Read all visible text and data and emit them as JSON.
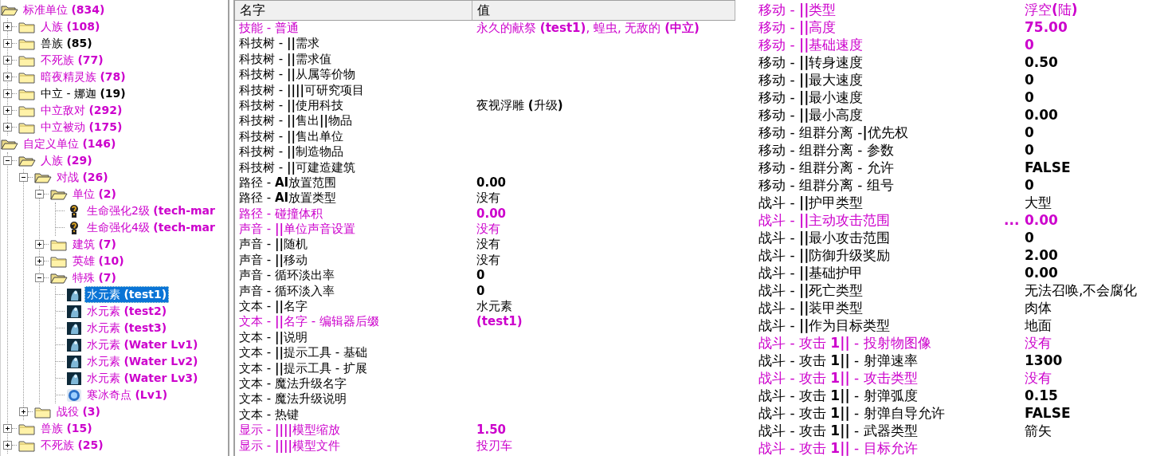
{
  "tree": [
    {
      "label": "标准单位 **(834)**",
      "kind": "folder",
      "expanded": true,
      "highlighted": true,
      "selected": false,
      "children": [
        {
          "label": "人族 **(108)**",
          "kind": "folder",
          "expanded": false,
          "highlighted": true,
          "selected": false
        },
        {
          "label": "兽族 **(85)**",
          "kind": "folder",
          "expanded": false,
          "highlighted": false,
          "selected": false
        },
        {
          "label": "不死族 **(77)**",
          "kind": "folder",
          "expanded": false,
          "highlighted": true,
          "selected": false
        },
        {
          "label": "暗夜精灵族 **(78)**",
          "kind": "folder",
          "expanded": false,
          "highlighted": true,
          "selected": false
        },
        {
          "label": "中立 - 娜迦 **(19)**",
          "kind": "folder",
          "expanded": false,
          "highlighted": false,
          "selected": false
        },
        {
          "label": "中立敌对 **(292)**",
          "kind": "folder",
          "expanded": false,
          "highlighted": true,
          "selected": false
        },
        {
          "label": "中立被动 **(175)**",
          "kind": "folder",
          "expanded": false,
          "highlighted": true,
          "selected": false
        }
      ]
    },
    {
      "label": "自定义单位 **(146)**",
      "kind": "folder",
      "expanded": true,
      "highlighted": true,
      "selected": false,
      "children": [
        {
          "label": "人族 **(29)**",
          "kind": "folder",
          "expanded": true,
          "highlighted": true,
          "selected": false,
          "children": [
            {
              "label": "对战 **(26)**",
              "kind": "folder",
              "expanded": true,
              "highlighted": true,
              "selected": false,
              "children": [
                {
                  "label": "单位 **(2)**",
                  "kind": "folder",
                  "expanded": true,
                  "highlighted": true,
                  "selected": false,
                  "children": [
                    {
                      "label": "生命强化2级 **(tech-mar**",
                      "kind": "upgrade",
                      "highlighted": true,
                      "selected": false
                    },
                    {
                      "label": "生命强化4级 **(tech-mar**",
                      "kind": "upgrade",
                      "highlighted": true,
                      "selected": false
                    }
                  ]
                },
                {
                  "label": "建筑 **(7)**",
                  "kind": "folder",
                  "expanded": false,
                  "highlighted": true,
                  "selected": false
                },
                {
                  "label": "英雄 **(10)**",
                  "kind": "folder",
                  "expanded": false,
                  "highlighted": true,
                  "selected": false
                },
                {
                  "label": "特殊 **(7)**",
                  "kind": "folder",
                  "expanded": true,
                  "highlighted": true,
                  "selected": false,
                  "children": [
                    {
                      "label": "水元素 **(test1)**",
                      "kind": "water",
                      "highlighted": true,
                      "selected": true
                    },
                    {
                      "label": "水元素 **(test2)**",
                      "kind": "water",
                      "highlighted": true,
                      "selected": false
                    },
                    {
                      "label": "水元素 **(test3)**",
                      "kind": "water",
                      "highlighted": true,
                      "selected": false
                    },
                    {
                      "label": "水元素 **(Water Lv1)**",
                      "kind": "water",
                      "highlighted": true,
                      "selected": false
                    },
                    {
                      "label": "水元素 **(Water Lv2)**",
                      "kind": "water",
                      "highlighted": true,
                      "selected": false
                    },
                    {
                      "label": "水元素 **(Water Lv3)**",
                      "kind": "water",
                      "highlighted": true,
                      "selected": false
                    },
                    {
                      "label": "寒冰奇点 **(Lv1)**",
                      "kind": "ice",
                      "highlighted": true,
                      "selected": false
                    }
                  ]
                }
              ]
            },
            {
              "label": "战役 **(3)**",
              "kind": "folder",
              "expanded": false,
              "highlighted": true,
              "selected": false
            }
          ]
        },
        {
          "label": "兽族 **(15)**",
          "kind": "folder",
          "expanded": false,
          "highlighted": true,
          "selected": false
        },
        {
          "label": "不死族 **(25)**",
          "kind": "folder",
          "expanded": false,
          "highlighted": true,
          "selected": false
        }
      ]
    }
  ],
  "table": {
    "columns": [
      "名字",
      "值"
    ],
    "rows": [
      {
        "name": "技能 - 普通",
        "value": "永久的献祭 **(test1)**, 蝗虫, 无敌的 **(中立)**",
        "kind": "text",
        "highlighted": true
      },
      {
        "name": "科技树 - **||**需求",
        "highlighted": false
      },
      {
        "name": "科技树 - **||**需求值",
        "highlighted": false
      },
      {
        "name": "科技树 - **||**从属等价物",
        "highlighted": false
      },
      {
        "name": "科技树 - **||||**可研究项目",
        "highlighted": false
      },
      {
        "name": "科技树 - **||**使用科技",
        "value": "夜视浮雕 **(**升级**)**",
        "kind": "text",
        "highlighted": false
      },
      {
        "name": "科技树 - **||**售出**||**物品",
        "highlighted": false
      },
      {
        "name": "科技树 - **||**售出单位",
        "highlighted": false
      },
      {
        "name": "科技树 - **||**制造物品",
        "highlighted": false
      },
      {
        "name": "科技树 - **||**可建造建筑",
        "highlighted": false
      },
      {
        "name": "路径 - **AI**放置范围",
        "value": "0.00",
        "kind": "number",
        "highlighted": false
      },
      {
        "name": "路径 - **AI**放置类型",
        "value": "没有",
        "kind": "text",
        "highlighted": false
      },
      {
        "name": "路径 - 碰撞体积",
        "value": "0.00",
        "kind": "number",
        "highlighted": true
      },
      {
        "name": "声音 - **||**单位声音设置",
        "value": "没有",
        "kind": "text",
        "highlighted": true
      },
      {
        "name": "声音 - **||**随机",
        "value": "没有",
        "kind": "text",
        "highlighted": false
      },
      {
        "name": "声音 - **||**移动",
        "value": "没有",
        "kind": "text",
        "highlighted": false
      },
      {
        "name": "声音 - 循环淡出率",
        "value": "0",
        "kind": "number",
        "highlighted": false
      },
      {
        "name": "声音 - 循环淡入率",
        "value": "0",
        "kind": "number",
        "highlighted": false
      },
      {
        "name": "文本 - **||**名字",
        "value": "水元素",
        "kind": "text",
        "highlighted": false
      },
      {
        "name": "文本 - **||**名字 - 编辑器后缀",
        "value": "(test1)",
        "kind": "number",
        "highlighted": true
      },
      {
        "name": "文本 - **||**说明",
        "highlighted": false
      },
      {
        "name": "文本 - **||**提示工具 - 基础",
        "highlighted": false
      },
      {
        "name": "文本 - **||**提示工具 - 扩展",
        "highlighted": false
      },
      {
        "name": "文本 - 魔法升级名字",
        "highlighted": false
      },
      {
        "name": "文本 - 魔法升级说明",
        "highlighted": false
      },
      {
        "name": "文本 - 热键",
        "highlighted": false
      },
      {
        "name": "显示 - **||||**模型缩放",
        "value": "1.50",
        "kind": "number",
        "highlighted": true
      },
      {
        "name": "显示 - **||||**模型文件",
        "value": "投刃车",
        "kind": "text",
        "highlighted": true
      }
    ]
  },
  "detail_list": [
    {
      "name": "移动 - **||**类型",
      "value": "浮空**(**陆**)**",
      "kind": "text",
      "highlighted": true
    },
    {
      "name": "移动 - **||**高度",
      "value": "75.00",
      "kind": "number",
      "highlighted": true
    },
    {
      "name": "移动 - **||**基础速度",
      "value": "0",
      "kind": "number",
      "highlighted": true
    },
    {
      "name": "移动 - **||**转身速度",
      "value": "0.50",
      "kind": "number",
      "highlighted": false
    },
    {
      "name": "移动 - **||**最大速度",
      "value": "0",
      "kind": "number",
      "highlighted": false
    },
    {
      "name": "移动 - **||**最小速度",
      "value": "0",
      "kind": "number",
      "highlighted": false
    },
    {
      "name": "移动 - **||**最小高度",
      "value": "0.00",
      "kind": "number",
      "highlighted": false
    },
    {
      "name": "移动 - 组群分离 -**|**优先权",
      "value": "0",
      "kind": "number",
      "highlighted": false
    },
    {
      "name": "移动 - 组群分离 - 参数",
      "value": "0",
      "kind": "number",
      "highlighted": false
    },
    {
      "name": "移动 - 组群分离 - 允许",
      "value": "FALSE",
      "kind": "number",
      "highlighted": false
    },
    {
      "name": "移动 - 组群分离 - 组号",
      "value": "0",
      "kind": "number",
      "highlighted": false
    },
    {
      "name": "战斗 - **||**护甲类型",
      "value": "大型",
      "kind": "text",
      "highlighted": false
    },
    {
      "name": "战斗 - **||**主动攻击范围",
      "marker": "...",
      "value": "0.00",
      "kind": "number",
      "highlighted": true
    },
    {
      "name": "战斗 - **||**最小攻击范围",
      "value": "0",
      "kind": "number",
      "highlighted": false
    },
    {
      "name": "战斗 - **||**防御升级奖励",
      "value": "2.00",
      "kind": "number",
      "highlighted": false
    },
    {
      "name": "战斗 - **||**基础护甲",
      "value": "0.00",
      "kind": "number",
      "highlighted": false
    },
    {
      "name": "战斗 - **||**死亡类型",
      "value": "无法召唤,不会腐化",
      "kind": "text",
      "highlighted": false
    },
    {
      "name": "战斗 - **||**装甲类型",
      "value": "肉体",
      "kind": "text",
      "highlighted": false
    },
    {
      "name": "战斗 - **||**作为目标类型",
      "value": "地面",
      "kind": "text",
      "highlighted": false
    },
    {
      "name": "战斗 - 攻击 **1||** - 投射物图像",
      "value": "没有",
      "kind": "text",
      "highlighted": true
    },
    {
      "name": "战斗 - 攻击 **1||** - 射弹速率",
      "value": "1300",
      "kind": "number",
      "highlighted": false
    },
    {
      "name": "战斗 - 攻击 **1||** - 攻击类型",
      "value": "没有",
      "kind": "text",
      "highlighted": true
    },
    {
      "name": "战斗 - 攻击 **1||** - 射弹弧度",
      "value": "0.15",
      "kind": "number",
      "highlighted": false
    },
    {
      "name": "战斗 - 攻击 **1||** - 射弹自导允许",
      "value": "FALSE",
      "kind": "number",
      "highlighted": false
    },
    {
      "name": "战斗 - 攻击 **1||** - 武器类型",
      "value": "箭矢",
      "kind": "text",
      "highlighted": false
    },
    {
      "name": "战斗 - 攻击 **1||** - 目标允许",
      "highlighted": true
    }
  ]
}
